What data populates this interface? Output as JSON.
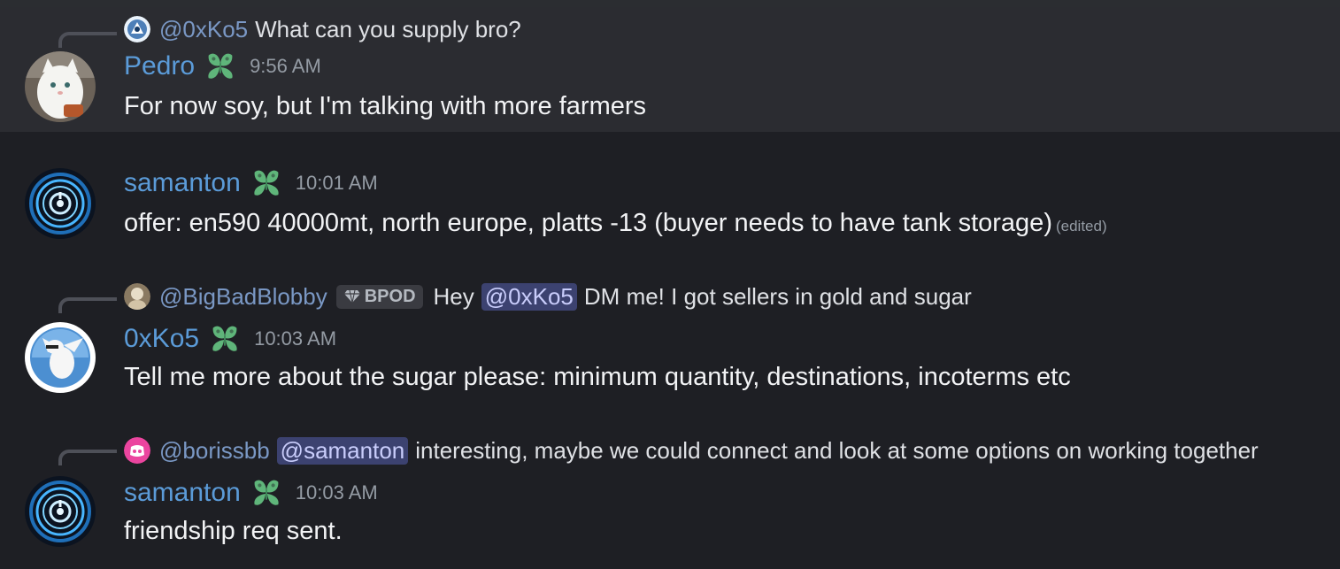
{
  "messages": [
    {
      "reply": {
        "name": "@0xKo5",
        "text": "What can you supply bro?"
      },
      "author": "Pedro",
      "time": "9:56 AM",
      "content": "For now soy, but I'm talking with more farmers"
    },
    {
      "author": "samanton",
      "time": "10:01 AM",
      "content": "offer: en590 40000mt, north europe, platts -13 (buyer needs to have tank storage)",
      "edited": "(edited)"
    },
    {
      "reply": {
        "name": "@BigBadBlobby",
        "tag": "BPOD",
        "pre": "Hey",
        "mention": "@0xKo5",
        "text": "DM me! I got sellers in gold and sugar"
      },
      "author": "0xKo5",
      "time": "10:03 AM",
      "content": "Tell me more about the sugar please: minimum quantity, destinations, incoterms etc"
    },
    {
      "reply": {
        "name": "@borissbb",
        "mention": "@samanton",
        "text": "interesting, maybe we could connect and look at some options on working together"
      },
      "author": "samanton",
      "time": "10:03 AM",
      "content": "friendship req sent."
    }
  ],
  "colors": {
    "background": "#1e1f24",
    "highlight": "#2b2c31",
    "username": "#5b9bd8",
    "badge": "#5fb57a",
    "mention_bg": "#3c4270"
  },
  "icons": [
    "reply-spine",
    "avatar",
    "server-tag-badge-icon",
    "gem-icon",
    "discord-icon"
  ]
}
